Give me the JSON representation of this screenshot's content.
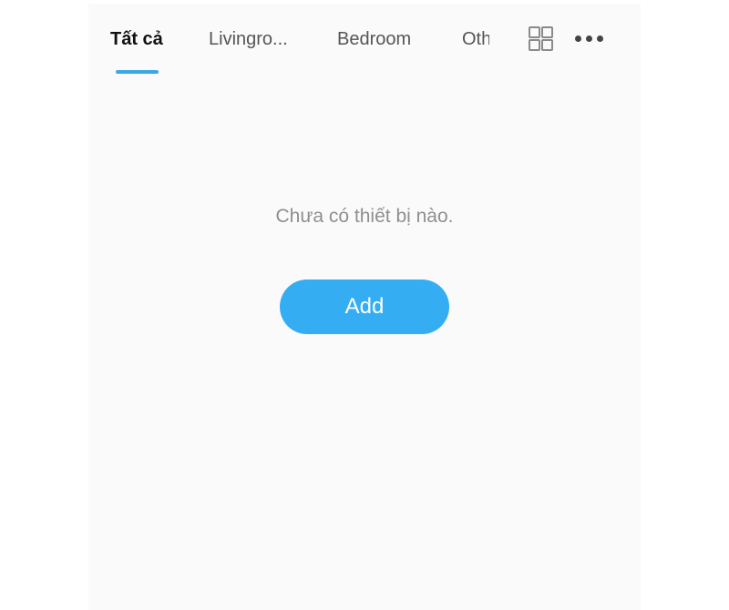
{
  "tabs": [
    {
      "label": "Tất cả",
      "active": true
    },
    {
      "label": "Livingro...",
      "active": false
    },
    {
      "label": "Bedroom",
      "active": false
    },
    {
      "label": "Oth",
      "active": false
    }
  ],
  "toolbar": {
    "grid_icon": "grid-view-icon",
    "more_icon": "more-options-icon"
  },
  "empty_state": {
    "message": "Chưa có thiết bị nào.",
    "add_label": "Add"
  },
  "colors": {
    "accent": "#35adf2",
    "indicator": "#3aa8e6",
    "background": "#fafafa"
  }
}
